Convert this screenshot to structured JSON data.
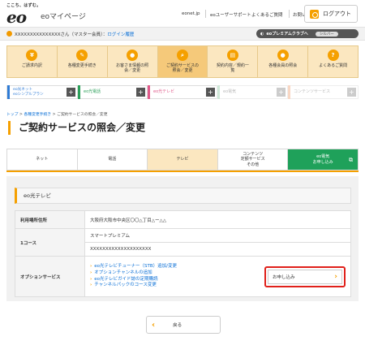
{
  "header": {
    "tagline": "ここち、はずむ。",
    "logo": "eo",
    "site_title": "eoマイページ",
    "links": [
      "eonet.jp",
      "eoユーザーサポート",
      "よくあるご質問",
      "お問い合わせ"
    ],
    "logout_label": "ログアウト"
  },
  "userbar": {
    "masked_name": "XXXXXXXXXXXXXXX",
    "suffix": "さん（マスター会員）",
    "login_history": "ログイン履歴",
    "premium_label": "eoプレミアムクラブへ",
    "rank": "シルバー"
  },
  "nav": [
    {
      "icon": "¥",
      "label": "ご請求内訳"
    },
    {
      "icon": "✎",
      "label": "各種変更手続き"
    },
    {
      "icon": "●",
      "label": "お客さま情報の照\n会／変更"
    },
    {
      "icon": "⌕",
      "label": "ご契約サービスの\n照会／変更"
    },
    {
      "icon": "▤",
      "label": "契約内容／規約一\n覧"
    },
    {
      "icon": "●",
      "label": "各種会員の照会"
    },
    {
      "icon": "?",
      "label": "よくあるご質問"
    }
  ],
  "services": [
    {
      "name": "eo光ネット\neoシンプルプラン",
      "color": "#2e7bd6"
    },
    {
      "name": "eo光電話",
      "color": "#2ca05a"
    },
    {
      "name": "eo光テレビ",
      "color": "#e05a8a"
    },
    {
      "name": "eo電気",
      "color": "#cfe8d8"
    },
    {
      "name": "コンテンツサービス",
      "color": "#f8d7c4"
    }
  ],
  "breadcrumb": [
    "トップ",
    "各種変更手続き",
    "ご契約サービスの照会／変更"
  ],
  "page_title": "ご契約サービスの照会／変更",
  "categories": [
    "ネット",
    "電話",
    "テレビ",
    "コンテンツ\n定額サービス\nその他",
    "eo電気\nお申し込み"
  ],
  "section_title": "eo光テレビ",
  "table": {
    "address_label": "利用場所住所",
    "address_value": "大阪府大阪市中央区〇〇△丁目△ー△△",
    "course_label": "1コース",
    "course_value": "スマートプレミアム",
    "course_id": "XXXXXXXXXXXXXXXXXXXX",
    "option_label": "オプションサービス",
    "option_links": [
      "eo光テレビチューナー（STB）追加/変更",
      "オプションチャンネルの追加",
      "eo光テレビガイド誌の定期購読",
      "チャンネルパックのコース変更"
    ],
    "apply_label": "お申し込み"
  },
  "back_label": "戻る"
}
